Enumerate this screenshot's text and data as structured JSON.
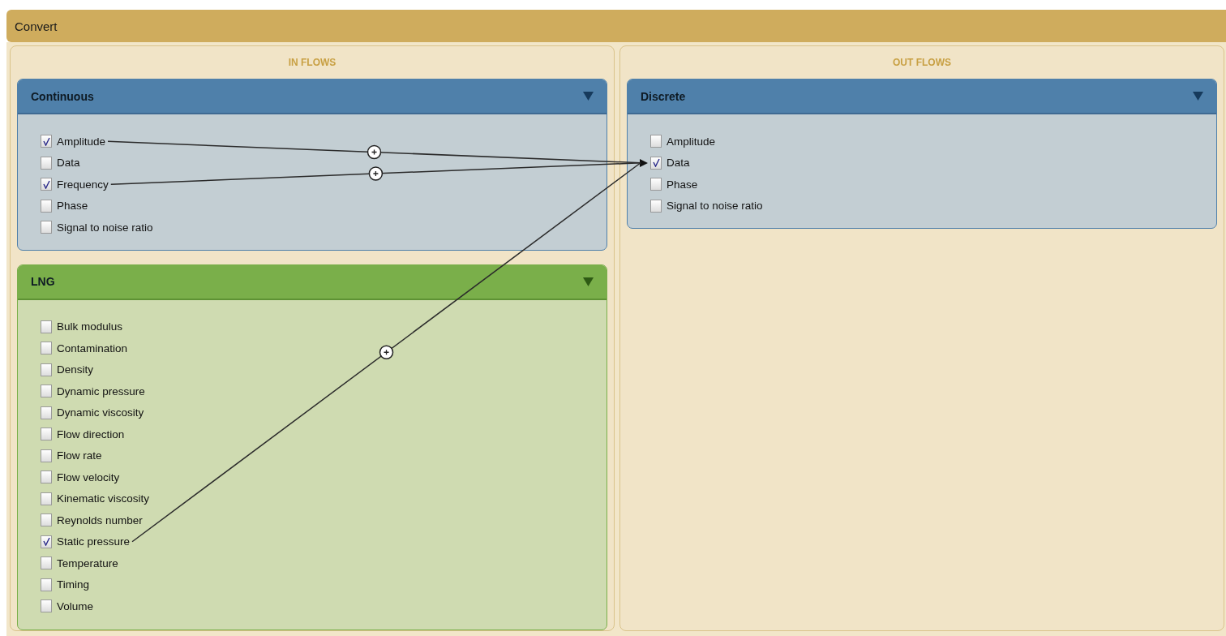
{
  "window": {
    "title": "Convert"
  },
  "columns": [
    {
      "title": "IN FLOWS",
      "groups": [
        {
          "name": "Continuous",
          "kind": "blue",
          "expanded": true,
          "items": [
            {
              "label": "Amplitude",
              "checked": true,
              "connected": true
            },
            {
              "label": "Data",
              "checked": false,
              "connected": false
            },
            {
              "label": "Frequency",
              "checked": true,
              "connected": true
            },
            {
              "label": "Phase",
              "checked": false,
              "connected": false
            },
            {
              "label": "Signal to noise ratio",
              "checked": false,
              "connected": false
            }
          ]
        },
        {
          "name": "LNG",
          "kind": "green",
          "expanded": true,
          "items": [
            {
              "label": "Bulk modulus",
              "checked": false,
              "connected": false
            },
            {
              "label": "Contamination",
              "checked": false,
              "connected": false
            },
            {
              "label": "Density",
              "checked": false,
              "connected": false
            },
            {
              "label": "Dynamic pressure",
              "checked": false,
              "connected": false
            },
            {
              "label": "Dynamic viscosity",
              "checked": false,
              "connected": false
            },
            {
              "label": "Flow direction",
              "checked": false,
              "connected": false
            },
            {
              "label": "Flow rate",
              "checked": false,
              "connected": false
            },
            {
              "label": "Flow velocity",
              "checked": false,
              "connected": false
            },
            {
              "label": "Kinematic viscosity",
              "checked": false,
              "connected": false
            },
            {
              "label": "Reynolds number",
              "checked": false,
              "connected": false
            },
            {
              "label": "Static pressure",
              "checked": true,
              "connected": true
            },
            {
              "label": "Temperature",
              "checked": false,
              "connected": false
            },
            {
              "label": "Timing",
              "checked": false,
              "connected": false
            },
            {
              "label": "Volume",
              "checked": false,
              "connected": false
            }
          ]
        }
      ]
    },
    {
      "title": "OUT FLOWS",
      "groups": [
        {
          "name": "Discrete",
          "kind": "blue",
          "expanded": true,
          "items": [
            {
              "label": "Amplitude",
              "checked": false,
              "connected": false
            },
            {
              "label": "Data",
              "checked": true,
              "connected": true
            },
            {
              "label": "Phase",
              "checked": false,
              "connected": false
            },
            {
              "label": "Signal to noise ratio",
              "checked": false,
              "connected": false
            }
          ]
        }
      ]
    }
  ]
}
